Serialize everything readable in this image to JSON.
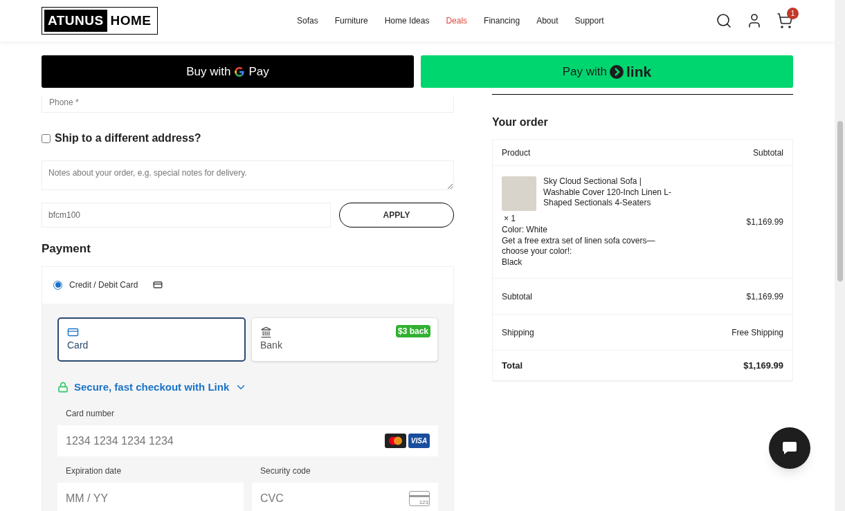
{
  "header": {
    "logo": [
      "ATUNUS",
      "HOME"
    ],
    "nav": [
      {
        "label": "Sofas",
        "highlighted": false
      },
      {
        "label": "Furniture",
        "highlighted": false
      },
      {
        "label": "Home Ideas",
        "highlighted": false
      },
      {
        "label": "Deals",
        "highlighted": true
      },
      {
        "label": "Financing",
        "highlighted": false
      },
      {
        "label": "About",
        "highlighted": false
      },
      {
        "label": "Support",
        "highlighted": false
      }
    ],
    "cart_count": "1"
  },
  "express": {
    "gpay": [
      "Buy with",
      "Pay"
    ],
    "link": [
      "Pay with",
      "link"
    ]
  },
  "billing": {
    "phone": {
      "placeholder": "Phone *"
    },
    "ship_different": {
      "label": "Ship to a different address?",
      "checked": false
    },
    "notes": {
      "placeholder": "Notes about your order, e.g. special notes for delivery."
    },
    "coupon": {
      "value": "bfcm100",
      "button": "APPLY"
    }
  },
  "payment": {
    "title": "Payment",
    "method": {
      "label": "Credit / Debit Card",
      "selected": true
    },
    "tabs": [
      {
        "kind": "card",
        "label": "Card",
        "selected": true
      },
      {
        "kind": "bank",
        "label": "Bank",
        "selected": false,
        "badge": "$3 back"
      }
    ],
    "link_prompt": "Secure, fast checkout with Link",
    "card_number": {
      "label": "Card number",
      "placeholder": "1234 1234 1234 1234",
      "brand": "VISA"
    },
    "expiry": {
      "label": "Expiration date",
      "placeholder": "MM / YY"
    },
    "cvc": {
      "label": "Security code",
      "placeholder": "CVC",
      "icon_text": "123"
    }
  },
  "order": {
    "title": "Your order",
    "columns": [
      "Product",
      "Subtotal"
    ],
    "item": {
      "name": "Sky Cloud Sectional Sofa | Washable Cover 120-Inch Linen L-Shaped Sectionals 4-Seaters",
      "qty": "× 1",
      "meta": [
        "Color: White",
        "Get a free extra set of linen sofa covers—choose your color!:",
        "Black"
      ],
      "price": "$1,169.99"
    },
    "rows": [
      {
        "kind": "normal",
        "label": "Subtotal",
        "value": "$1,169.99"
      },
      {
        "kind": "normal",
        "label": "Shipping",
        "value": "Free Shipping"
      },
      {
        "kind": "total",
        "label": "Total",
        "value": "$1,169.99"
      }
    ]
  }
}
